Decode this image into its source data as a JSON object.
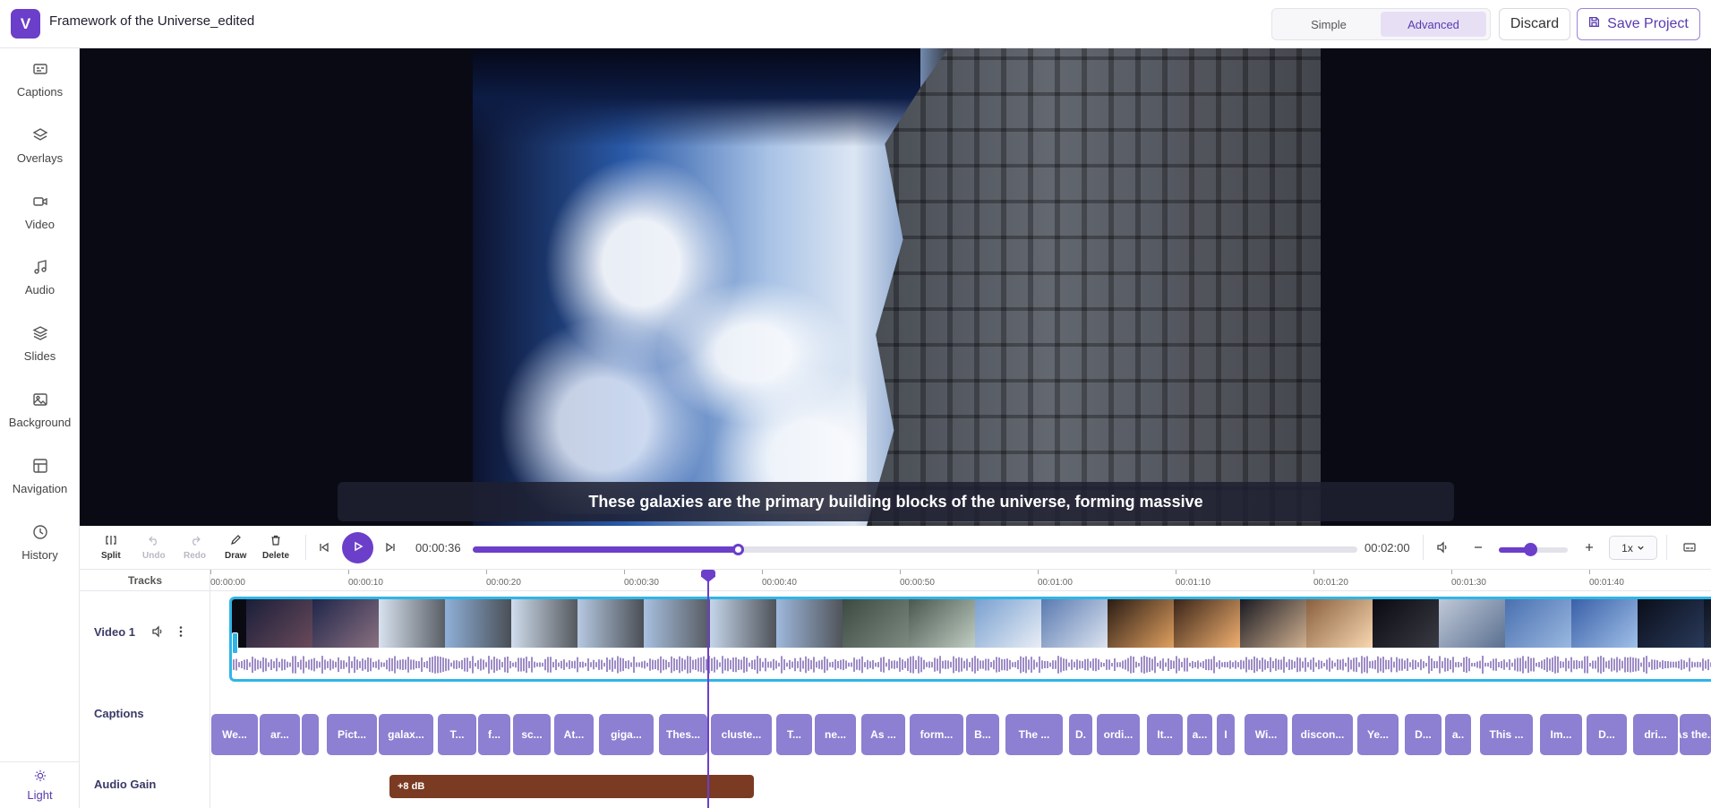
{
  "app": {
    "logo_letter": "V",
    "project_title": "Framework of the Universe_edited",
    "accent_color": "#6b3fc9"
  },
  "header": {
    "mode_simple": "Simple",
    "mode_advanced": "Advanced",
    "active_mode": "Advanced",
    "discard_label": "Discard",
    "save_label": "Save Project"
  },
  "sidebar": {
    "items": [
      {
        "label": "Captions",
        "icon": "captions-icon"
      },
      {
        "label": "Overlays",
        "icon": "layers-icon"
      },
      {
        "label": "Video",
        "icon": "video-camera-icon"
      },
      {
        "label": "Audio",
        "icon": "music-note-icon"
      },
      {
        "label": "Slides",
        "icon": "slides-stack-icon"
      },
      {
        "label": "Background",
        "icon": "image-icon"
      },
      {
        "label": "Navigation",
        "icon": "layout-icon"
      },
      {
        "label": "History",
        "icon": "history-icon"
      }
    ],
    "theme_label": "Light",
    "theme_icon": "sun-icon"
  },
  "preview": {
    "caption_text": "These galaxies are the primary building blocks of the universe, forming massive"
  },
  "controls": {
    "tools": [
      {
        "label": "Split",
        "icon": "split-icon",
        "enabled": true
      },
      {
        "label": "Undo",
        "icon": "undo-icon",
        "enabled": false
      },
      {
        "label": "Redo",
        "icon": "redo-icon",
        "enabled": false
      },
      {
        "label": "Draw",
        "icon": "pencil-icon",
        "enabled": true
      },
      {
        "label": "Delete",
        "icon": "trash-icon",
        "enabled": true
      }
    ],
    "current_time": "00:00:36",
    "total_time": "00:02:00",
    "progress": 0.3,
    "zoom_level": 0.45,
    "speed": "1x"
  },
  "timeline": {
    "tracks_header": "Tracks",
    "ruler_ticks": [
      "00:00:00",
      "00:00:10",
      "00:00:20",
      "00:00:30",
      "00:00:40",
      "00:00:50",
      "00:01:00",
      "00:01:10",
      "00:01:20",
      "00:01:30",
      "00:01:40"
    ],
    "tracks": {
      "video": "Video 1",
      "captions": "Captions",
      "audio_gain": "Audio Gain"
    },
    "gain_label": "+8 dB",
    "captions": [
      "We...",
      "ar...",
      "",
      "Pict...",
      "galax...",
      "T...",
      "f...",
      "sc...",
      "At...",
      "giga...",
      "Thes...",
      "cluste...",
      "T...",
      "ne...",
      "As ...",
      "form...",
      "B...",
      "The ...",
      "D.",
      "ordi...",
      "It...",
      "a...",
      "I",
      "Wi...",
      "discon...",
      "Ye...",
      "D...",
      "a..",
      "This ...",
      "Im...",
      "D...",
      "dri...",
      "As the..."
    ]
  }
}
